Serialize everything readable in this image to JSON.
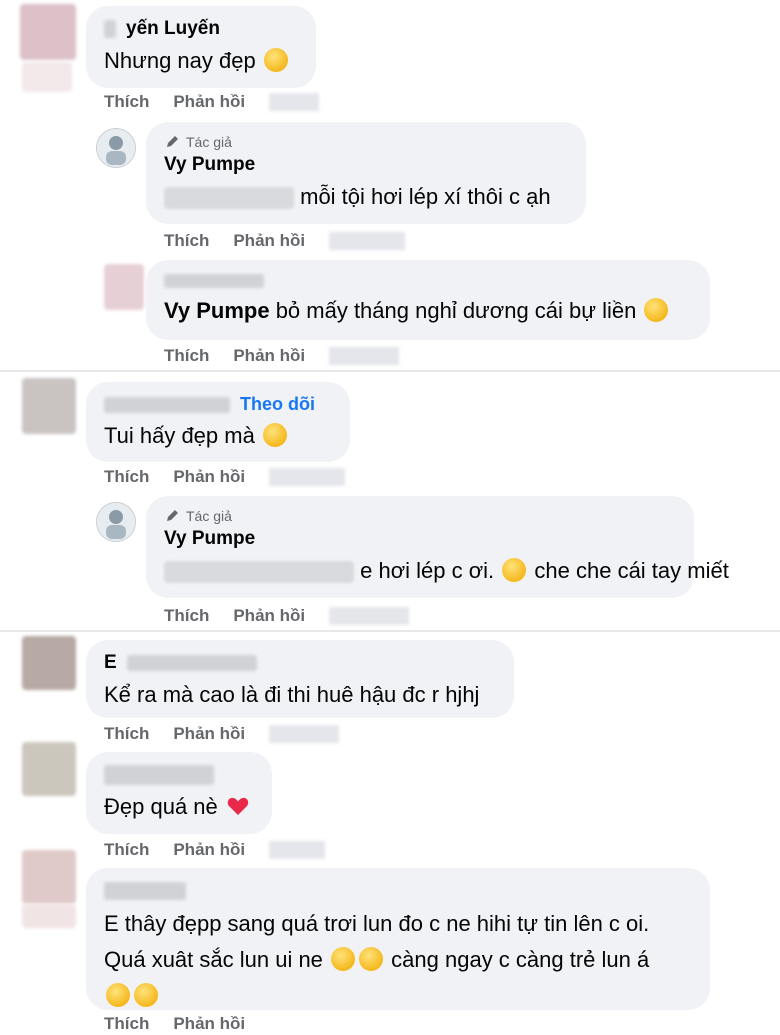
{
  "comments": [
    {
      "name": "yến Luyến",
      "text": "Nhưng nay đẹp",
      "emoji": "heart-eyes-emoji",
      "actions": {
        "like": "Thích",
        "reply": "Phản hồi"
      }
    },
    {
      "author_label": "Tác giả",
      "name": "Vy Pumpe",
      "text": "mỗi tội hơi lép xí thôi c ạh",
      "actions": {
        "like": "Thích",
        "reply": "Phản hồi"
      }
    },
    {
      "mention": "Vy Pumpe",
      "text": "bỏ mấy tháng nghỉ dương cái bự liền",
      "emoji": "grin-emoji",
      "actions": {
        "like": "Thích",
        "reply": "Phản hồi"
      }
    },
    {
      "follow_label": "Theo dõi",
      "text": "Tui hấy đẹp mà",
      "emoji": "smiling-hearts-emoji",
      "actions": {
        "like": "Thích",
        "reply": "Phản hồi"
      }
    },
    {
      "author_label": "Tác giả",
      "name": "Vy Pumpe",
      "text_mid": "e hơi lép c ơi.",
      "text_end": "che che cái tay miết",
      "emoji": "tear-emoji",
      "actions": {
        "like": "Thích",
        "reply": "Phản hồi"
      }
    },
    {
      "name_initial": "E",
      "text": "Kể ra mà cao là đi thi huê hậu đc r hjhj",
      "actions": {
        "like": "Thích",
        "reply": "Phản hồi"
      }
    },
    {
      "text": "Đẹp quá nè",
      "emoji": "heart-emoji",
      "actions": {
        "like": "Thích",
        "reply": "Phản hồi"
      }
    },
    {
      "line1": "E thây đẹpp sang quá trơi lun đo c ne hihi tự tin lên c oi.",
      "line2_a": "Quá xuât sắc lun ui ne",
      "line2_b": "càng ngay c càng trẻ lun á",
      "emoji": "kiss-emoji",
      "actions": {
        "like": "Thích",
        "reply": "Phản hồi"
      }
    }
  ],
  "colors": {
    "bubble": "#f0f2f5",
    "follow": "#1877f2",
    "meta": "#65676b"
  }
}
